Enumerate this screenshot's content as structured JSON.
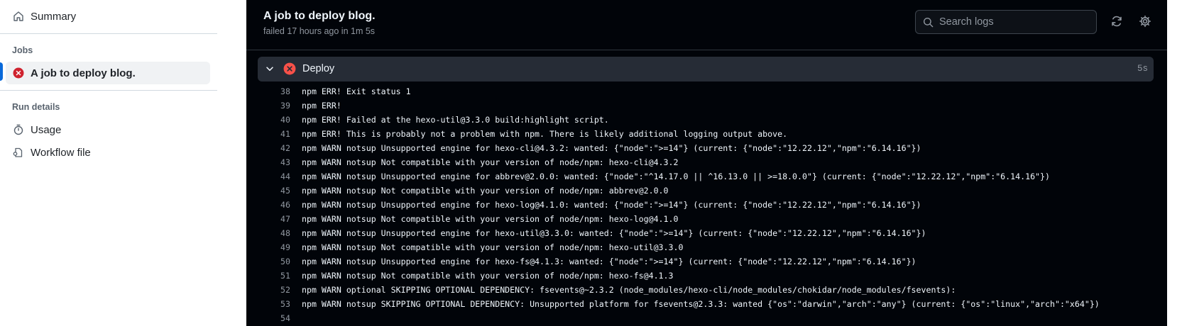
{
  "sidebar": {
    "summary_label": "Summary",
    "jobs_heading": "Jobs",
    "job_label": "A job to deploy blog.",
    "run_details_heading": "Run details",
    "usage_label": "Usage",
    "workflow_file_label": "Workflow file"
  },
  "header": {
    "title": "A job to deploy blog.",
    "subtitle": "failed 17 hours ago in 1m 5s",
    "search_placeholder": "Search logs"
  },
  "step": {
    "name": "Deploy",
    "duration": "5s"
  },
  "log_lines": [
    {
      "n": "38",
      "text": "npm ERR! Exit status 1"
    },
    {
      "n": "39",
      "text": "npm ERR!"
    },
    {
      "n": "40",
      "text": "npm ERR! Failed at the hexo-util@3.3.0 build:highlight script."
    },
    {
      "n": "41",
      "text": "npm ERR! This is probably not a problem with npm. There is likely additional logging output above."
    },
    {
      "n": "42",
      "text": "npm WARN notsup Unsupported engine for hexo-cli@4.3.2: wanted: {\"node\":\">=14\"} (current: {\"node\":\"12.22.12\",\"npm\":\"6.14.16\"})"
    },
    {
      "n": "43",
      "text": "npm WARN notsup Not compatible with your version of node/npm: hexo-cli@4.3.2"
    },
    {
      "n": "44",
      "text": "npm WARN notsup Unsupported engine for abbrev@2.0.0: wanted: {\"node\":\"^14.17.0 || ^16.13.0 || >=18.0.0\"} (current: {\"node\":\"12.22.12\",\"npm\":\"6.14.16\"})"
    },
    {
      "n": "45",
      "text": "npm WARN notsup Not compatible with your version of node/npm: abbrev@2.0.0"
    },
    {
      "n": "46",
      "text": "npm WARN notsup Unsupported engine for hexo-log@4.1.0: wanted: {\"node\":\">=14\"} (current: {\"node\":\"12.22.12\",\"npm\":\"6.14.16\"})"
    },
    {
      "n": "47",
      "text": "npm WARN notsup Not compatible with your version of node/npm: hexo-log@4.1.0"
    },
    {
      "n": "48",
      "text": "npm WARN notsup Unsupported engine for hexo-util@3.3.0: wanted: {\"node\":\">=14\"} (current: {\"node\":\"12.22.12\",\"npm\":\"6.14.16\"})"
    },
    {
      "n": "49",
      "text": "npm WARN notsup Not compatible with your version of node/npm: hexo-util@3.3.0"
    },
    {
      "n": "50",
      "text": "npm WARN notsup Unsupported engine for hexo-fs@4.1.3: wanted: {\"node\":\">=14\"} (current: {\"node\":\"12.22.12\",\"npm\":\"6.14.16\"})"
    },
    {
      "n": "51",
      "text": "npm WARN notsup Not compatible with your version of node/npm: hexo-fs@4.1.3"
    },
    {
      "n": "52",
      "text": "npm WARN optional SKIPPING OPTIONAL DEPENDENCY: fsevents@~2.3.2 (node_modules/hexo-cli/node_modules/chokidar/node_modules/fsevents):"
    },
    {
      "n": "53",
      "text": "npm WARN notsup SKIPPING OPTIONAL DEPENDENCY: Unsupported platform for fsevents@2.3.3: wanted {\"os\":\"darwin\",\"arch\":\"any\"} (current: {\"os\":\"linux\",\"arch\":\"x64\"})"
    },
    {
      "n": "54",
      "text": ""
    }
  ],
  "colors": {
    "fail": "#f85149",
    "accent": "#0969da",
    "log_bg": "#010409",
    "step_bg": "#262c36"
  }
}
